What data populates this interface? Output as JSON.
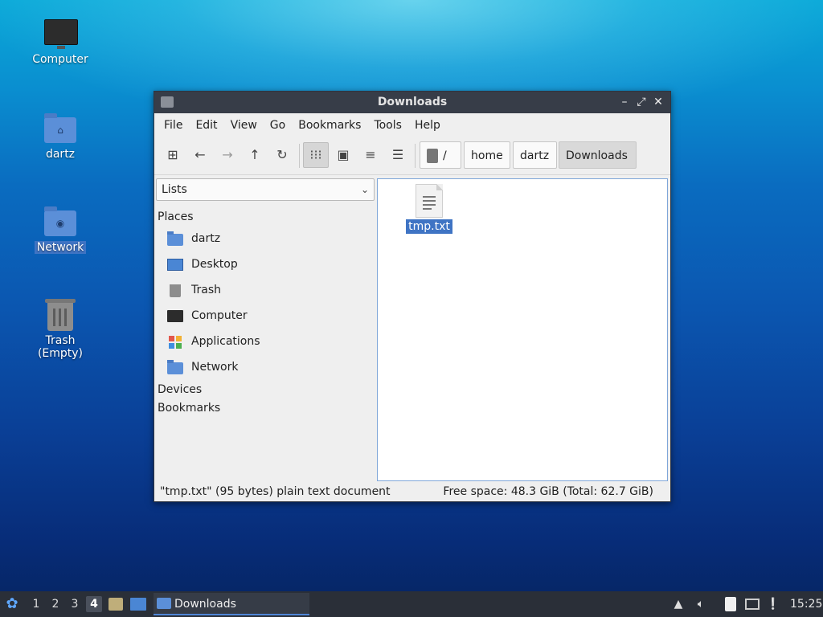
{
  "desktop": {
    "icons": [
      {
        "label": "Computer"
      },
      {
        "label": "dartz"
      },
      {
        "label": "Network"
      },
      {
        "label": "Trash (Empty)"
      }
    ]
  },
  "window": {
    "title": "Downloads",
    "controls": {
      "minimize": "–",
      "maximize": "⤢",
      "close": "✕"
    }
  },
  "menubar": {
    "items": [
      "File",
      "Edit",
      "View",
      "Go",
      "Bookmarks",
      "Tools",
      "Help"
    ]
  },
  "toolbar": {
    "path_root": "/",
    "path_segments": [
      "home",
      "dartz",
      "Downloads"
    ],
    "active_view": "icon-view"
  },
  "sidebar": {
    "mode": "Lists",
    "places_header": "Places",
    "places": [
      "dartz",
      "Desktop",
      "Trash",
      "Computer",
      "Applications",
      "Network"
    ],
    "devices_header": "Devices",
    "bookmarks_header": "Bookmarks"
  },
  "files": [
    {
      "name": "tmp.txt",
      "selected": true
    }
  ],
  "status": {
    "left": "\"tmp.txt\" (95 bytes) plain text document",
    "right": "Free space: 48.3 GiB (Total: 62.7 GiB)"
  },
  "taskbar": {
    "workspaces": [
      "1",
      "2",
      "3",
      "4"
    ],
    "active_workspace": "4",
    "task_title": "Downloads",
    "clock": "15:25"
  },
  "colors": {
    "selection": "#3f74c4",
    "titlebar": "#373d48",
    "taskbar": "#2a2f38"
  }
}
